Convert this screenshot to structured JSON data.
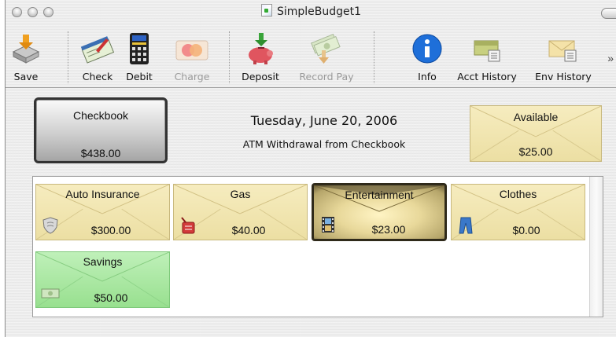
{
  "window": {
    "title": "SimpleBudget1"
  },
  "toolbar": {
    "items": [
      {
        "label": "Save",
        "icon": "save-icon",
        "enabled": true
      },
      {
        "label": "Check",
        "icon": "check-icon",
        "enabled": true
      },
      {
        "label": "Debit",
        "icon": "debit-icon",
        "enabled": true
      },
      {
        "label": "Charge",
        "icon": "charge-icon",
        "enabled": false
      },
      {
        "label": "Deposit",
        "icon": "deposit-icon",
        "enabled": true
      },
      {
        "label": "Record Pay",
        "icon": "record-pay-icon",
        "enabled": false
      },
      {
        "label": "Info",
        "icon": "info-icon",
        "enabled": true
      },
      {
        "label": "Acct History",
        "icon": "acct-history-icon",
        "enabled": true
      },
      {
        "label": "Env History",
        "icon": "env-history-icon",
        "enabled": true
      }
    ],
    "overflow_glyph": "»"
  },
  "account": {
    "name": "Checkbook",
    "balance": "$438.00"
  },
  "summary": {
    "date": "Tuesday, June 20, 2006",
    "last_transaction": "ATM Withdrawal from Checkbook"
  },
  "available": {
    "name": "Available",
    "amount": "$25.00"
  },
  "envelopes": [
    {
      "name": "Auto Insurance",
      "amount": "$300.00",
      "icon": "shield-icon",
      "color": "yellow",
      "selected": false
    },
    {
      "name": "Gas",
      "amount": "$40.00",
      "icon": "gas-can-icon",
      "color": "yellow",
      "selected": false
    },
    {
      "name": "Entertainment",
      "amount": "$23.00",
      "icon": "film-icon",
      "color": "yellow",
      "selected": true
    },
    {
      "name": "Clothes",
      "amount": "$0.00",
      "icon": "jeans-icon",
      "color": "yellow",
      "selected": false
    },
    {
      "name": "Savings",
      "amount": "$50.00",
      "icon": "money-icon",
      "color": "green",
      "selected": false
    }
  ],
  "colors": {
    "envelope_yellow": "#f1e4ad",
    "envelope_green": "#a8e6a0",
    "info_blue": "#1e6fd9"
  }
}
